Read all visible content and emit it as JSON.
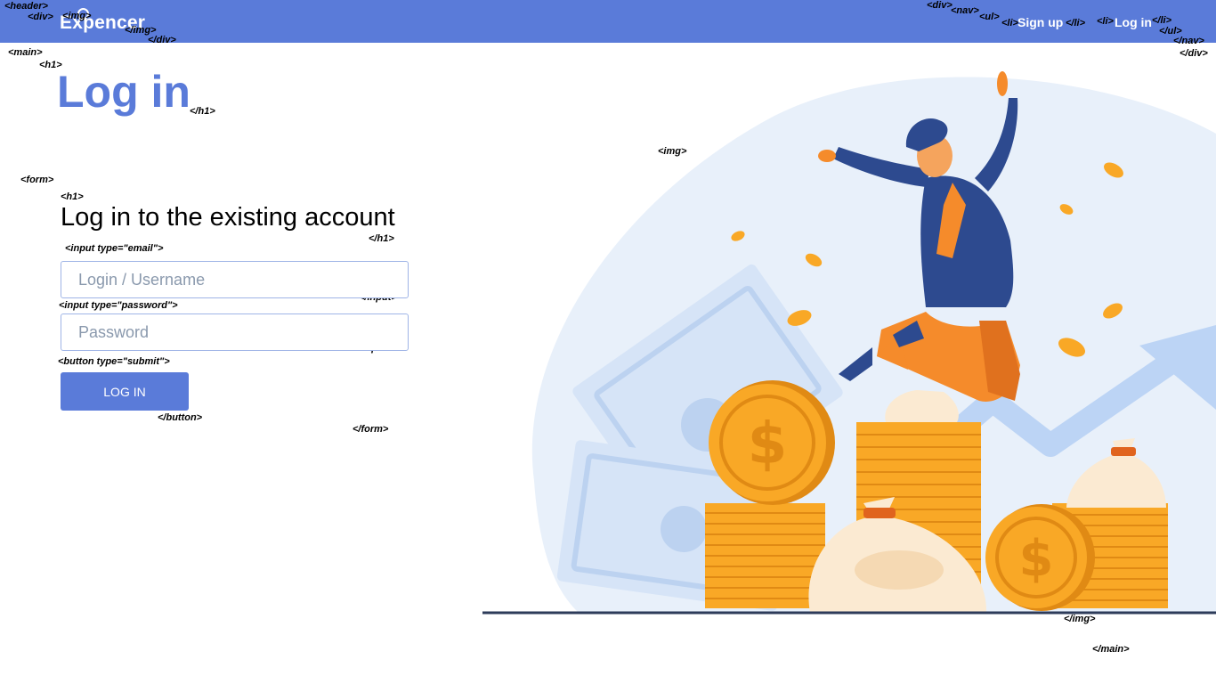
{
  "tags": {
    "header_open": "<header>",
    "div_open": "<div>",
    "img_open": "<img>",
    "img_close": "</img>",
    "div_close": "</div>",
    "nav_div_open": "<div>",
    "nav_open": "<nav>",
    "ul_open": "<ul>",
    "li_open_1": "<li>",
    "li_close_1": "</li>",
    "li_open_2": "<li>",
    "li_close_2": "</li>",
    "ul_close": "</ul>",
    "nav_close": "</nav>",
    "nav_div_close": "</div>",
    "main_open": "<main>",
    "h1_open": "<h1>",
    "h1_close": "</h1>",
    "form_open": "<form>",
    "form_h1_open": "<h1>",
    "form_h1_close": "</h1>",
    "input_email_open": "<input type=\"email\">",
    "input_email_close": "</input>",
    "input_password_open": "<input type=\"password\">",
    "input_password_close": "</input>",
    "button_open": "<button type=\"submit\">",
    "button_close": "</button>",
    "form_close": "</form>",
    "main_img_open": "<img>",
    "main_img_close": "</img>",
    "main_close": "</main>"
  },
  "header": {
    "logo_text": "Expencer",
    "nav": {
      "signup_label": "Sign up",
      "login_label": "Log in"
    }
  },
  "main": {
    "title": "Log in",
    "form": {
      "title": "Log in to the existing account",
      "username_placeholder": "Login / Username",
      "password_placeholder": "Password",
      "submit_label": "LOG IN"
    }
  },
  "colors": {
    "accent": "#5a7bd9",
    "coin": "#f9a826",
    "jacket": "#2d4a8f",
    "pants": "#f58b2b"
  },
  "illustration": "celebrating-man-with-coins"
}
